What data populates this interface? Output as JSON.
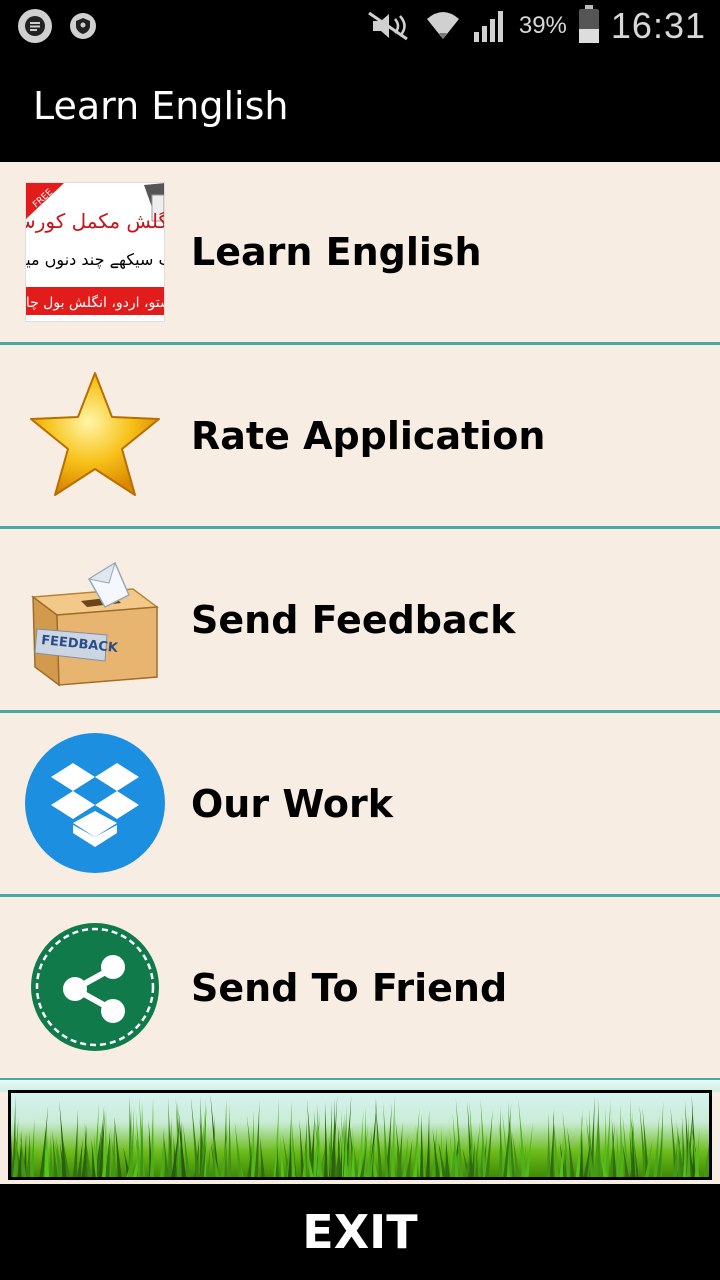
{
  "status_bar": {
    "battery_percent": "39%",
    "time": "16:31",
    "icons": [
      "chat-notification-icon",
      "shield-notification-icon",
      "mute-icon",
      "wifi-icon",
      "signal-icon",
      "battery-icon"
    ]
  },
  "action_bar": {
    "title": "Learn English"
  },
  "menu": {
    "items": [
      {
        "label": "Learn English",
        "icon": "urdu-course-banner-icon",
        "icon_text": [
          "FREE",
          "انگلش مکمل کورس",
          "اب سیکھے چند دنوں میں",
          "پشتو، اردو، انگلش بول چال"
        ]
      },
      {
        "label": "Rate Application",
        "icon": "star-icon"
      },
      {
        "label": "Send Feedback",
        "icon": "feedback-box-icon",
        "icon_text": [
          "FEEDBACK"
        ]
      },
      {
        "label": "Our Work",
        "icon": "dropbox-icon"
      },
      {
        "label": "Send To Friend",
        "icon": "share-icon"
      }
    ]
  },
  "exit": {
    "label": "EXIT"
  },
  "colors": {
    "background": "#f8ede3",
    "divider": "#4aa7a6",
    "bar": "#000000"
  }
}
